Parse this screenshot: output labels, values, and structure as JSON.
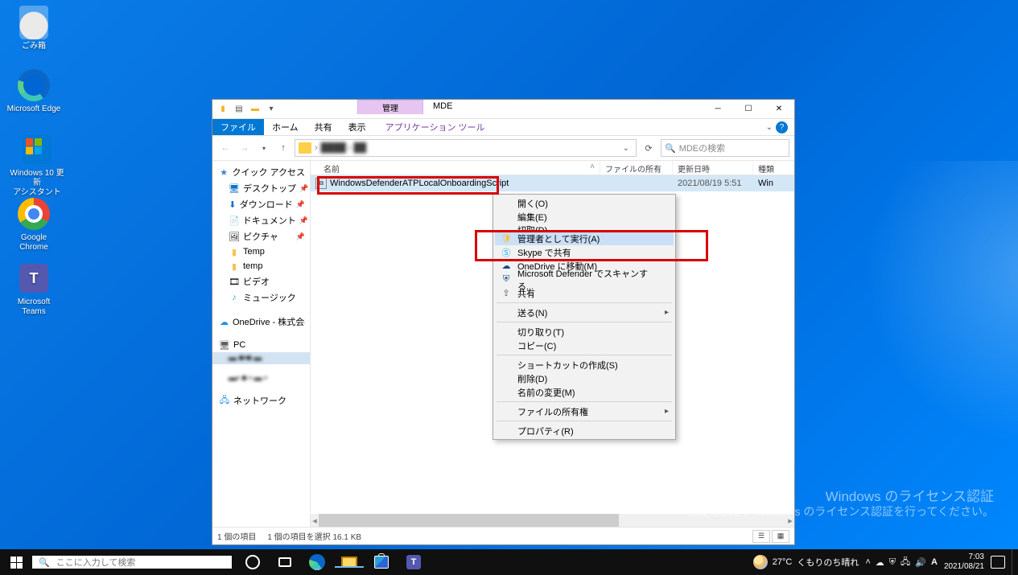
{
  "desktop": {
    "icons": [
      {
        "name": "recycle-bin",
        "label": "ごみ箱"
      },
      {
        "name": "edge",
        "label": "Microsoft Edge"
      },
      {
        "name": "win-update-assistant",
        "label": "Windows 10 更新\nアシスタント"
      },
      {
        "name": "chrome",
        "label": "Google Chrome"
      },
      {
        "name": "teams",
        "label": "Microsoft Teams"
      }
    ]
  },
  "explorer": {
    "tool_context": "管理",
    "title": "MDE",
    "tabs": {
      "file": "ファイル",
      "home": "ホーム",
      "share": "共有",
      "view": "表示",
      "app_tools": "アプリケーション ツール"
    },
    "search": {
      "placeholder": "MDEの検索"
    },
    "columns": {
      "name": "名前",
      "owner": "ファイルの所有権",
      "modified": "更新日時",
      "type": "種類"
    },
    "files": [
      {
        "icon": "cmd",
        "name": "WindowsDefenderATPLocalOnboardingScript",
        "owner": "",
        "modified": "2021/08/19 5:51",
        "type": "Win"
      }
    ],
    "nav": {
      "quick_access": "クイック アクセス",
      "desktop": "デスクトップ",
      "downloads": "ダウンロード",
      "documents": "ドキュメント",
      "pictures": "ピクチャ",
      "temp1": "Temp",
      "temp2": "temp",
      "videos": "ビデオ",
      "music": "ミュージック",
      "onedrive": "OneDrive - 株式会社",
      "pc": "PC",
      "network": "ネットワーク"
    },
    "status": {
      "count": "1 個の項目",
      "selected": "1 個の項目を選択 16.1 KB"
    }
  },
  "context_menu": {
    "open": "開く(O)",
    "edit": "編集(E)",
    "cut_partial": "切取(D)",
    "run_as_admin": "管理者として実行(A)",
    "skype": "Skype で共有",
    "onedrive_move": "OneDrive に移動(M)",
    "defender_scan": "Microsoft Defender でスキャンする...",
    "share": "共有",
    "send_to": "送る(N)",
    "cut": "切り取り(T)",
    "copy": "コピー(C)",
    "shortcut": "ショートカットの作成(S)",
    "delete": "削除(D)",
    "rename": "名前の変更(M)",
    "ownership": "ファイルの所有権",
    "properties": "プロパティ(R)"
  },
  "watermark": {
    "title": "Windows のライセンス認証",
    "sub": "設定を開き、Windows のライセンス認証を行ってください。"
  },
  "taskbar": {
    "search_placeholder": "ここに入力して検索",
    "weather": {
      "temp": "27°C",
      "text": "くもりのち晴れ"
    },
    "ime": "A",
    "time": "7:03",
    "date": "2021/08/21"
  }
}
